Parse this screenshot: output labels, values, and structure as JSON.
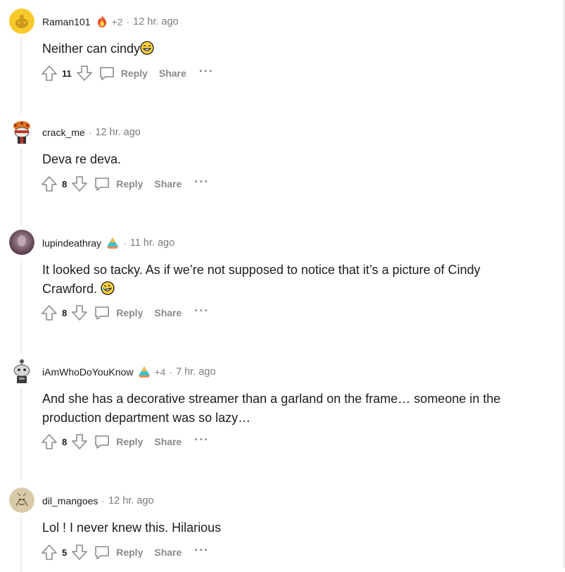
{
  "colors": {
    "meta_gray": "#878a8c",
    "thread_line": "#edeff1",
    "text": "#1c1c1c"
  },
  "actions": {
    "reply_label": "Reply",
    "share_label": "Share",
    "more_label": "···"
  },
  "comments": [
    {
      "username": "Raman101",
      "flair_icon": "fire-award-icon",
      "award_count": "+2",
      "timestamp": "12 hr. ago",
      "body": "Neither can cindy",
      "body_emoji": "grinning-face-icon",
      "votes": "11"
    },
    {
      "username": "crack_me",
      "timestamp": "12 hr. ago",
      "body": "Deva re deva.",
      "votes": "8"
    },
    {
      "username": "lupindeathray",
      "flair_icon": "pyramid-award-icon",
      "timestamp": "11 hr. ago",
      "body": "It looked so tacky. As if we’re not supposed to notice that it’s a picture of Cindy Crawford.",
      "body_emoji": "rolling-laughing-icon",
      "votes": "8"
    },
    {
      "username": "iAmWhoDoYouKnow",
      "flair_icon": "pyramid-award-icon",
      "award_count": "+4",
      "timestamp": "7 hr. ago",
      "body": "And she has a decorative streamer than a garland on the frame… someone in the production department was so lazy…",
      "votes": "8"
    },
    {
      "username": "dil_mangoes",
      "timestamp": "12 hr. ago",
      "body": "Lol ! I never knew this. Hilarious",
      "votes": "5"
    }
  ]
}
